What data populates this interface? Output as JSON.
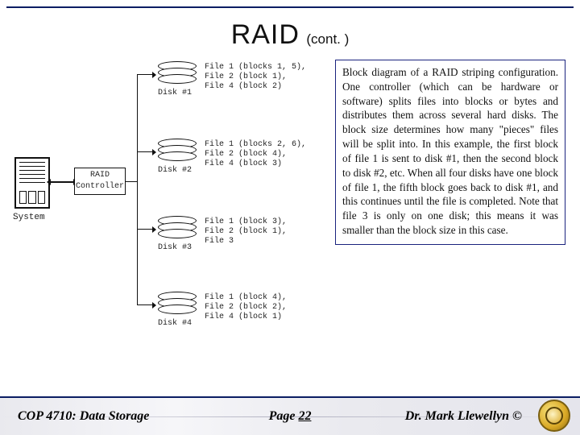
{
  "title": {
    "main": "RAID",
    "sub": "(cont. )"
  },
  "system_label": "System",
  "controller_label": "RAID\nController",
  "disks": [
    {
      "name": "Disk #1",
      "lines": [
        "File 1 (blocks 1, 5),",
        "File 2 (block 1),",
        "File 4 (block 2)"
      ]
    },
    {
      "name": "Disk #2",
      "lines": [
        "File 1 (blocks 2, 6),",
        "File 2 (block 4),",
        "File 4 (block 3)"
      ]
    },
    {
      "name": "Disk #3",
      "lines": [
        "File 1 (block 3),",
        "File 2 (block 1),",
        "File 3"
      ]
    },
    {
      "name": "Disk #4",
      "lines": [
        "File 1 (block 4),",
        "File 2 (block 2),",
        "File 4 (block 1)"
      ]
    }
  ],
  "explain": "Block diagram of a RAID striping configuration. One controller (which can be hardware or software) splits files into blocks or bytes and distributes them across several hard disks. The block size determines how many \"pieces\" files will be split into. In this example, the first block of file 1 is sent to disk #1, then the second block to disk #2, etc. When all four disks have one block of file 1, the fifth block goes back to disk #1, and this continues until the file is completed. Note that file 3 is only on one disk; this means it was smaller than the block size in this case.",
  "footer": {
    "course": "COP 4710: Data Storage",
    "page_label": "Page ",
    "page_num": "22",
    "author": "Dr. Mark Llewellyn ©"
  }
}
